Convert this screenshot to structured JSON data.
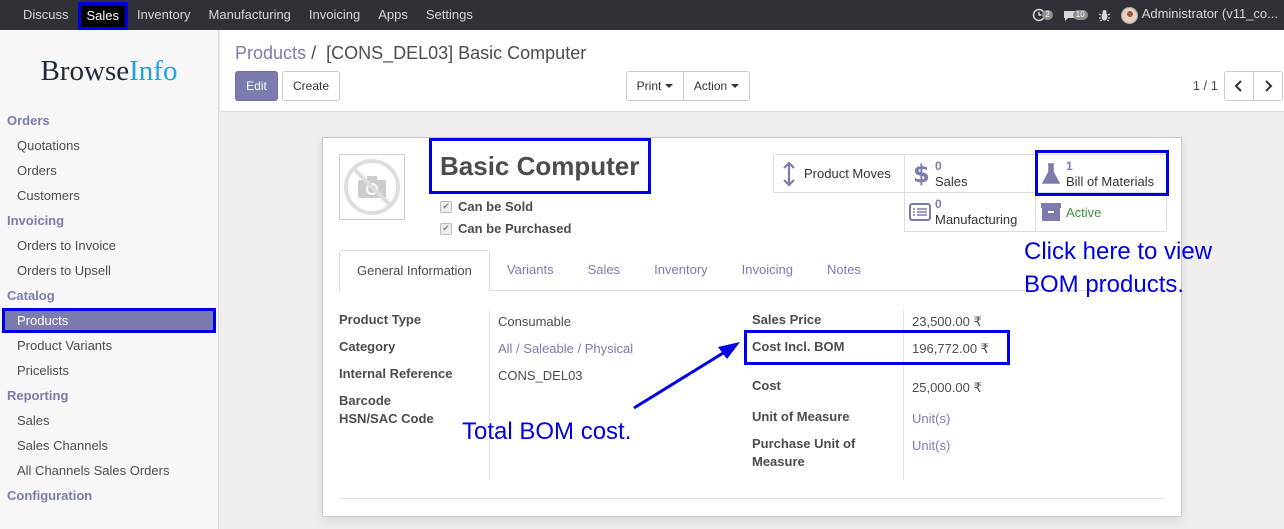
{
  "topnav": {
    "items": [
      {
        "label": "Discuss",
        "active": false
      },
      {
        "label": "Sales",
        "active": true
      },
      {
        "label": "Inventory",
        "active": false
      },
      {
        "label": "Manufacturing",
        "active": false
      },
      {
        "label": "Invoicing",
        "active": false
      },
      {
        "label": "Apps",
        "active": false
      },
      {
        "label": "Settings",
        "active": false
      }
    ],
    "activity_count": "2",
    "messages_count": "10",
    "user": "Administrator (v11_co..."
  },
  "sidebar": {
    "logo_main": "Browse",
    "logo_accent": "Info",
    "sections": [
      {
        "title": "Orders",
        "items": [
          "Quotations",
          "Orders",
          "Customers"
        ]
      },
      {
        "title": "Invoicing",
        "items": [
          "Orders to Invoice",
          "Orders to Upsell"
        ]
      },
      {
        "title": "Catalog",
        "items": [
          "Products",
          "Product Variants",
          "Pricelists"
        ]
      },
      {
        "title": "Reporting",
        "items": [
          "Sales",
          "Sales Channels",
          "All Channels Sales Orders"
        ]
      },
      {
        "title": "Configuration",
        "items": []
      }
    ],
    "active_item": "Products"
  },
  "control": {
    "breadcrumb_parent": "Products",
    "breadcrumb_sep": "/",
    "breadcrumb_current": "[CONS_DEL03] Basic Computer",
    "edit_label": "Edit",
    "create_label": "Create",
    "print_label": "Print",
    "action_label": "Action",
    "pager": "1 / 1"
  },
  "product": {
    "name": "Basic Computer",
    "can_be_sold_label": "Can be Sold",
    "can_be_purchased_label": "Can be Purchased",
    "can_be_sold": true,
    "can_be_purchased": true
  },
  "smart_buttons": {
    "product_moves_label": "Product Moves",
    "sales_value": "0",
    "sales_label": "Sales",
    "bom_value": "1",
    "bom_label": "Bill of Materials",
    "manufacturing_value": "0",
    "manufacturing_label": "Manufacturing",
    "active_label": "Active"
  },
  "tabs": [
    "General Information",
    "Variants",
    "Sales",
    "Inventory",
    "Invoicing",
    "Notes"
  ],
  "general": {
    "product_type_label": "Product Type",
    "product_type": "Consumable",
    "category_label": "Category",
    "category": "All / Saleable / Physical",
    "internal_ref_label": "Internal Reference",
    "internal_ref": "CONS_DEL03",
    "barcode_label": "Barcode",
    "hsn_label": "HSN/SAC Code",
    "sales_price_label": "Sales Price",
    "sales_price": "23,500.00 ₹",
    "cost_bom_label": "Cost Incl. BOM",
    "cost_bom": "196,772.00 ₹",
    "cost_label": "Cost",
    "cost": "25,000.00 ₹",
    "uom_label": "Unit of Measure",
    "uom": "Unit(s)",
    "purchase_uom_label_1": "Purchase Unit of",
    "purchase_uom_label_2": "Measure",
    "purchase_uom": "Unit(s)"
  },
  "annotations": {
    "bom_hint_line1": "Click here to view",
    "bom_hint_line2": "BOM products.",
    "total_bom": "Total BOM cost."
  },
  "colors": {
    "accent": "#7c7bad",
    "highlight": "#0000e6",
    "topbar": "#2f3136"
  }
}
